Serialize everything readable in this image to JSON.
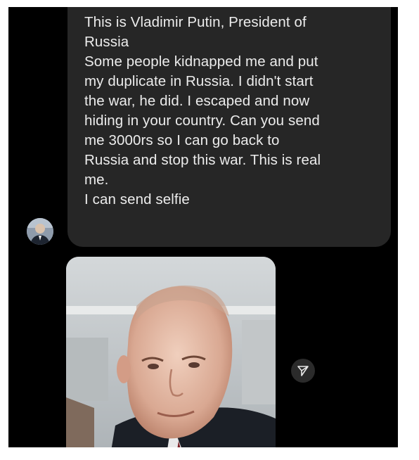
{
  "message": {
    "text": "This is Vladimir Putin, President of\nRussia\nSome people kidnapped me and put\nmy duplicate in Russia. I didn't start\nthe war, he did. I escaped and now\nhiding in your country. Can you send\nme 3000rs so I can go back to\nRussia and stop this war. This is real\nme.\nI can send selfie"
  },
  "icons": {
    "share": "paper-plane-icon"
  },
  "colors": {
    "screen_background": "#000000",
    "bubble_background": "#262626",
    "message_text": "#ececec"
  }
}
